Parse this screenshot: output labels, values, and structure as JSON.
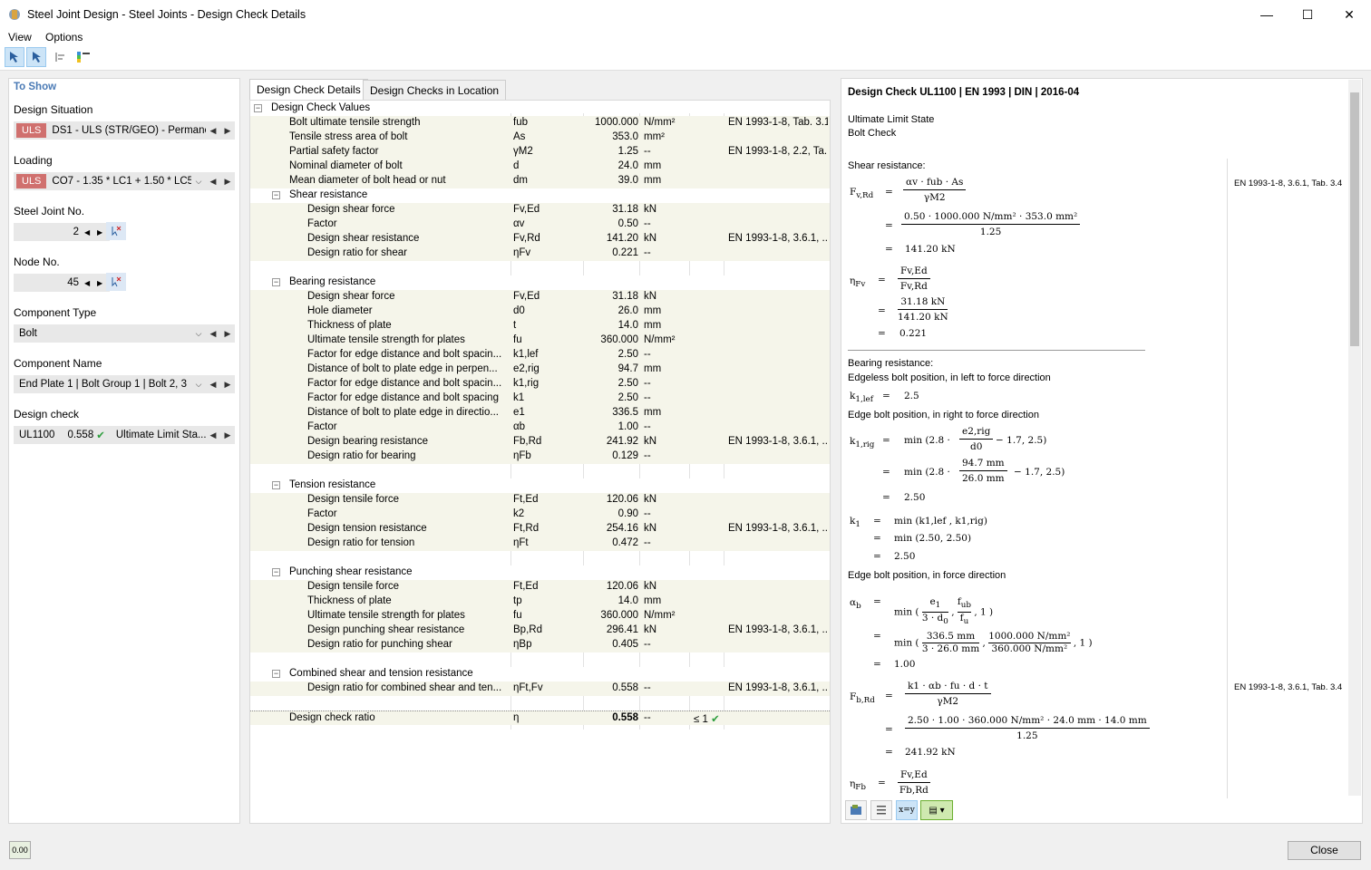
{
  "window": {
    "title": "Steel Joint Design - Steel Joints - Design Check Details",
    "minimize": "—",
    "maximize": "☐",
    "close": "✕"
  },
  "menu": {
    "view": "View",
    "options": "Options"
  },
  "left": {
    "title": "To Show",
    "design_situation_label": "Design Situation",
    "design_situation_badge": "ULS",
    "design_situation_value": "DS1 - ULS (STR/GEO) - Permane...",
    "loading_label": "Loading",
    "loading_badge": "ULS",
    "loading_value": "CO7 - 1.35 * LC1 + 1.50 * LC5...",
    "joint_label": "Steel Joint No.",
    "joint_value": "2",
    "node_label": "Node No.",
    "node_value": "45",
    "component_type_label": "Component Type",
    "component_type_value": "Bolt",
    "component_name_label": "Component Name",
    "component_name_value": "End Plate 1 | Bolt Group 1 | Bolt 2, 3",
    "design_check_label": "Design check",
    "design_check_id": "UL1100",
    "design_check_ratio": "0.558",
    "design_check_type": "Ultimate Limit Sta..."
  },
  "tabs": [
    "Design Check Details",
    "Design Checks in Location"
  ],
  "table": {
    "root": "Design Check Values",
    "top_rows": [
      {
        "name": "Bolt ultimate tensile strength",
        "sym": "fub",
        "val": "1000.000",
        "unit": "N/mm²",
        "ref": "EN 1993-1-8, Tab. 3.1"
      },
      {
        "name": "Tensile stress area of bolt",
        "sym": "As",
        "val": "353.0",
        "unit": "mm²",
        "ref": ""
      },
      {
        "name": "Partial safety factor",
        "sym": "γM2",
        "val": "1.25",
        "unit": "--",
        "ref": "EN 1993-1-8, 2.2, Ta..."
      },
      {
        "name": "Nominal diameter of bolt",
        "sym": "d",
        "val": "24.0",
        "unit": "mm",
        "ref": ""
      },
      {
        "name": "Mean diameter of bolt head or nut",
        "sym": "dm",
        "val": "39.0",
        "unit": "mm",
        "ref": ""
      }
    ],
    "groups": [
      {
        "title": "Shear resistance",
        "rows": [
          {
            "name": "Design shear force",
            "sym": "Fv,Ed",
            "val": "31.18",
            "unit": "kN",
            "ref": ""
          },
          {
            "name": "Factor",
            "sym": "αv",
            "val": "0.50",
            "unit": "--",
            "ref": ""
          },
          {
            "name": "Design shear resistance",
            "sym": "Fv,Rd",
            "val": "141.20",
            "unit": "kN",
            "ref": "EN 1993-1-8, 3.6.1, ..."
          },
          {
            "name": "Design ratio for shear",
            "sym": "ηFv",
            "val": "0.221",
            "unit": "--",
            "ref": ""
          }
        ]
      },
      {
        "title": "Bearing resistance",
        "rows": [
          {
            "name": "Design shear force",
            "sym": "Fv,Ed",
            "val": "31.18",
            "unit": "kN",
            "ref": ""
          },
          {
            "name": "Hole diameter",
            "sym": "d0",
            "val": "26.0",
            "unit": "mm",
            "ref": ""
          },
          {
            "name": "Thickness of plate",
            "sym": "t",
            "val": "14.0",
            "unit": "mm",
            "ref": ""
          },
          {
            "name": "Ultimate tensile strength for plates",
            "sym": "fu",
            "val": "360.000",
            "unit": "N/mm²",
            "ref": ""
          },
          {
            "name": "Factor for edge distance and bolt spacin...",
            "sym": "k1,lef",
            "val": "2.50",
            "unit": "--",
            "ref": ""
          },
          {
            "name": "Distance of bolt to plate edge in perpen...",
            "sym": "e2,rig",
            "val": "94.7",
            "unit": "mm",
            "ref": ""
          },
          {
            "name": "Factor for edge distance and bolt spacin...",
            "sym": "k1,rig",
            "val": "2.50",
            "unit": "--",
            "ref": ""
          },
          {
            "name": "Factor for edge distance and bolt spacing",
            "sym": "k1",
            "val": "2.50",
            "unit": "--",
            "ref": ""
          },
          {
            "name": "Distance of bolt to plate edge in directio...",
            "sym": "e1",
            "val": "336.5",
            "unit": "mm",
            "ref": ""
          },
          {
            "name": "Factor",
            "sym": "αb",
            "val": "1.00",
            "unit": "--",
            "ref": ""
          },
          {
            "name": "Design bearing resistance",
            "sym": "Fb,Rd",
            "val": "241.92",
            "unit": "kN",
            "ref": "EN 1993-1-8, 3.6.1, ..."
          },
          {
            "name": "Design ratio for bearing",
            "sym": "ηFb",
            "val": "0.129",
            "unit": "--",
            "ref": ""
          }
        ]
      },
      {
        "title": "Tension resistance",
        "rows": [
          {
            "name": "Design tensile force",
            "sym": "Ft,Ed",
            "val": "120.06",
            "unit": "kN",
            "ref": ""
          },
          {
            "name": "Factor",
            "sym": "k2",
            "val": "0.90",
            "unit": "--",
            "ref": ""
          },
          {
            "name": "Design tension resistance",
            "sym": "Ft,Rd",
            "val": "254.16",
            "unit": "kN",
            "ref": "EN 1993-1-8, 3.6.1, ..."
          },
          {
            "name": "Design ratio for tension",
            "sym": "ηFt",
            "val": "0.472",
            "unit": "--",
            "ref": ""
          }
        ]
      },
      {
        "title": "Punching shear resistance",
        "rows": [
          {
            "name": "Design tensile force",
            "sym": "Ft,Ed",
            "val": "120.06",
            "unit": "kN",
            "ref": ""
          },
          {
            "name": "Thickness of plate",
            "sym": "tp",
            "val": "14.0",
            "unit": "mm",
            "ref": ""
          },
          {
            "name": "Ultimate tensile strength for plates",
            "sym": "fu",
            "val": "360.000",
            "unit": "N/mm²",
            "ref": ""
          },
          {
            "name": "Design punching shear resistance",
            "sym": "Bp,Rd",
            "val": "296.41",
            "unit": "kN",
            "ref": "EN 1993-1-8, 3.6.1, ..."
          },
          {
            "name": "Design ratio for punching shear",
            "sym": "ηBp",
            "val": "0.405",
            "unit": "--",
            "ref": ""
          }
        ]
      },
      {
        "title": "Combined shear and tension resistance",
        "rows": [
          {
            "name": "Design ratio for combined shear and ten...",
            "sym": "ηFt,Fv",
            "val": "0.558",
            "unit": "--",
            "ref": "EN 1993-1-8, 3.6.1, ..."
          }
        ]
      }
    ],
    "final": {
      "name": "Design check ratio",
      "sym": "η",
      "val": "0.558",
      "unit": "--",
      "limit": "≤ 1"
    }
  },
  "details": {
    "heading": "Design Check UL1100 | EN 1993 | DIN | 2016-04",
    "state": "Ultimate Limit State",
    "check": "Bolt Check",
    "shear_title": "Shear resistance:",
    "ref1": "EN 1993-1-8, 3.6.1, Tab. 3.4",
    "ref2": "EN 1993-1-8, 3.6.1, Tab. 3.4",
    "fvrd_num": "αv · fub · As",
    "fvrd_den": "γM2",
    "fvrd_num2": "0.50 · 1000.000 N/mm² · 353.0 mm²",
    "fvrd_den2": "1.25",
    "fvrd_res": "141.20 kN",
    "etafv_num": "Fv,Ed",
    "etafv_den": "Fv,Rd",
    "etafv_num2": "31.18 kN",
    "etafv_den2": "141.20 kN",
    "etafv_res": "0.221",
    "bearing_title": "Bearing resistance:",
    "edgeless": "Edgeless bolt position, in left to force direction",
    "k1lef_val": "2.5",
    "edge_right": "Edge bolt position, in right to force direction",
    "k1rig_e1_num": "e2,rig",
    "k1rig_e1_den": "d0",
    "k1rig_e2_num": "94.7 mm",
    "k1rig_e2_den": "26.0 mm",
    "k1rig_res": "2.50",
    "k1_expr": "min (k1,lef , k1,rig)",
    "k1_expr2": "min (2.50, 2.50)",
    "k1_res": "2.50",
    "edge_force": "Edge bolt position, in force direction",
    "ab_res": "1.00",
    "fbrd_num": "k1 · αb · fu · d · t",
    "fbrd_den": "γM2",
    "fbrd_num2": "2.50 · 1.00 · 360.000 N/mm² · 24.0 mm · 14.0 mm",
    "fbrd_den2": "1.25",
    "fbrd_res": "241.92 kN",
    "etafb_num": "Fv,Ed",
    "etafb_den": "Fb,Rd"
  },
  "footer": {
    "close": "Close"
  }
}
